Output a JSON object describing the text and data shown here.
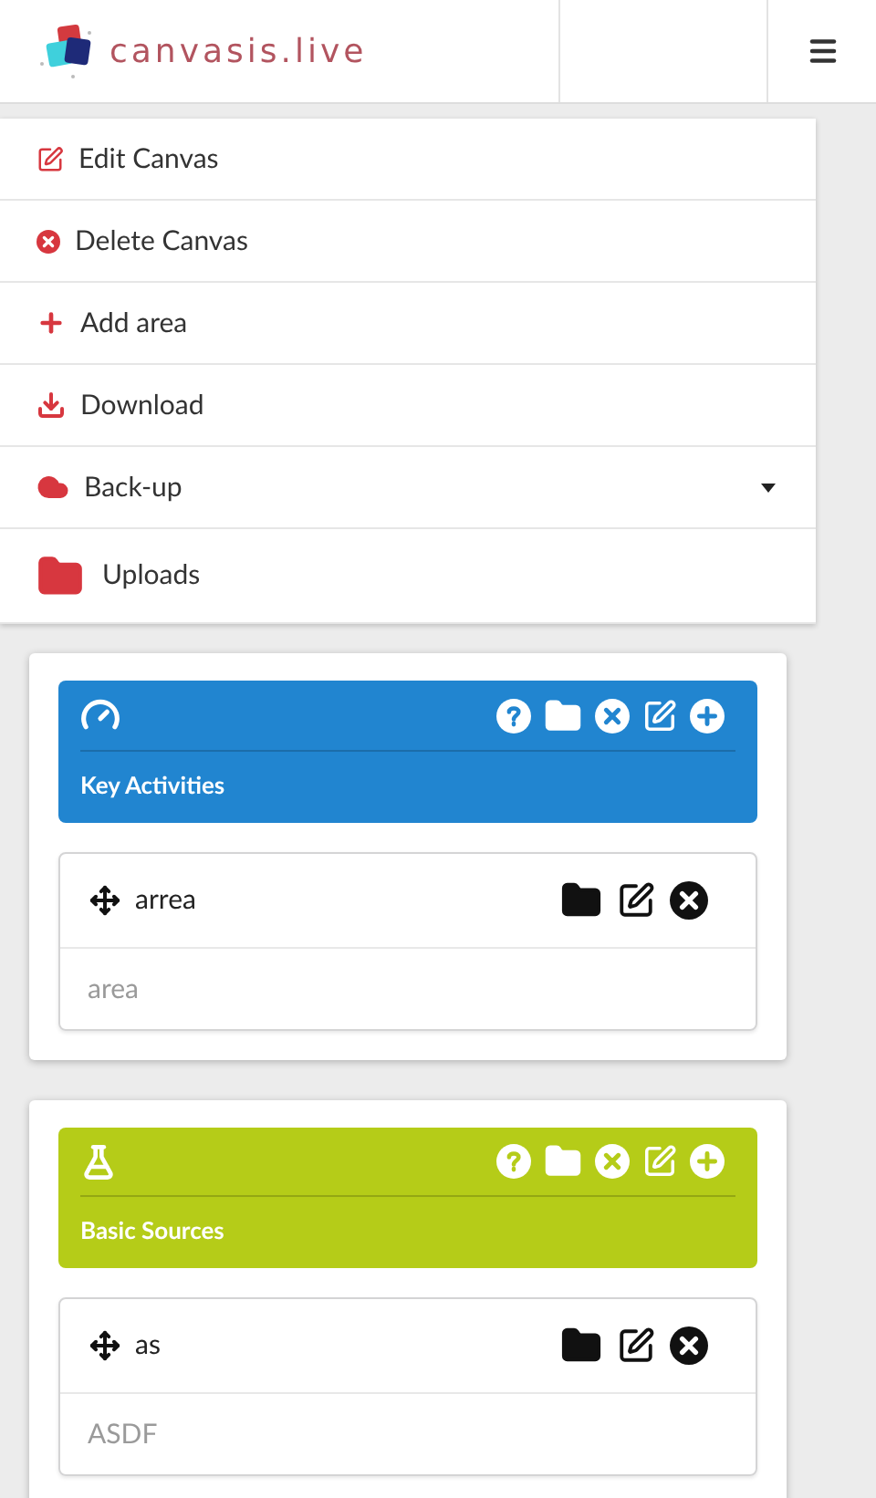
{
  "header": {
    "logo_text": "canvasis.live"
  },
  "menu": [
    {
      "label": "Edit Canvas",
      "kind": "edit",
      "expandable": false
    },
    {
      "label": "Delete Canvas",
      "kind": "delete",
      "expandable": false
    },
    {
      "label": "Add area",
      "kind": "add",
      "expandable": false
    },
    {
      "label": "Download",
      "kind": "download",
      "expandable": false
    },
    {
      "label": "Back-up",
      "kind": "cloud",
      "expandable": true
    },
    {
      "label": "Uploads",
      "kind": "folder",
      "expandable": false
    }
  ],
  "cards": [
    {
      "title": "Key Activities",
      "color": "#2185d0",
      "kind": "gauge",
      "items": [
        {
          "title": "arrea",
          "text": "area"
        }
      ]
    },
    {
      "title": "Basic Sources",
      "color": "#b5cc18",
      "kind": "flask",
      "items": [
        {
          "title": "as",
          "text": "ASDF"
        }
      ]
    }
  ]
}
